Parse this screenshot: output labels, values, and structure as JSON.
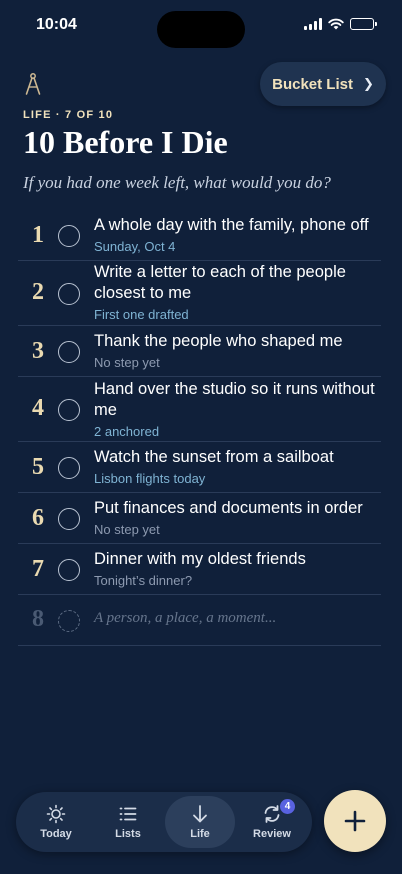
{
  "status_bar": {
    "time": "10:04"
  },
  "header": {
    "bucket_list_label": "Bucket List",
    "eyebrow": "LIFE · 7 OF 10",
    "title": "10 Before I Die",
    "subtitle": "If you had one week left, what would you do?"
  },
  "items": [
    {
      "number": "1",
      "title": "A whole day with the family, phone off",
      "sub": "Sunday, Oct 4",
      "sub_style": "blue"
    },
    {
      "number": "2",
      "title": "Write a letter to each of the people closest to me",
      "sub": "First one drafted",
      "sub_style": "blue"
    },
    {
      "number": "3",
      "title": "Thank the people who shaped me",
      "sub": "No step yet",
      "sub_style": "muted"
    },
    {
      "number": "4",
      "title": "Hand over the studio so it runs without me",
      "sub": "2 anchored",
      "sub_style": "blue"
    },
    {
      "number": "5",
      "title": "Watch the sunset from a sailboat",
      "sub": "Lisbon flights today",
      "sub_style": "blue"
    },
    {
      "number": "6",
      "title": "Put finances and documents in order",
      "sub": "No step yet",
      "sub_style": "muted"
    },
    {
      "number": "7",
      "title": "Dinner with my oldest friends",
      "sub": "Tonight’s dinner?",
      "sub_style": "muted"
    }
  ],
  "new_item": {
    "number": "8",
    "placeholder": "A person, a place, a moment..."
  },
  "tabs": [
    {
      "label": "Today",
      "icon": "sun-icon"
    },
    {
      "label": "Lists",
      "icon": "list-icon"
    },
    {
      "label": "Life",
      "icon": "arrow-down-icon",
      "active": true
    },
    {
      "label": "Review",
      "icon": "refresh-icon",
      "badge": "4"
    }
  ],
  "colors": {
    "background": "#10203a",
    "accent": "#f1e2bc",
    "badge": "#5962e0"
  }
}
